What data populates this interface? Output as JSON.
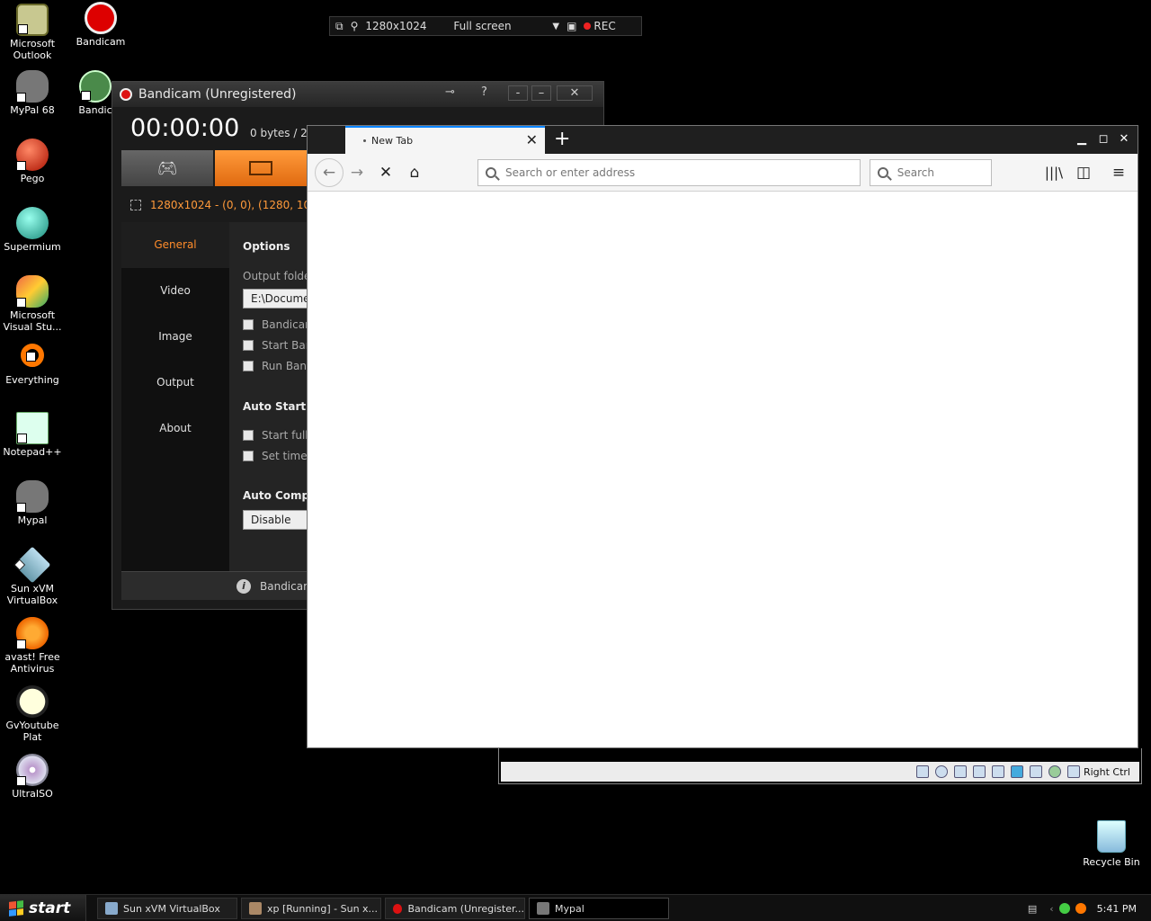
{
  "desktop": {
    "icons": [
      {
        "label": "Microsoft Outlook"
      },
      {
        "label": "Bandicam"
      },
      {
        "label": "MyPal 68"
      },
      {
        "label": "Bandic"
      },
      {
        "label": "Pego"
      },
      {
        "label": "Supermium"
      },
      {
        "label": "Microsoft Visual Stu..."
      },
      {
        "label": "Everything"
      },
      {
        "label": "Notepad++"
      },
      {
        "label": "Mypal"
      },
      {
        "label": "Sun xVM VirtualBox"
      },
      {
        "label": "avast! Free Antivirus"
      },
      {
        "label": "GvYoutube Plat"
      },
      {
        "label": "UltraISO"
      }
    ],
    "recycle_bin": "Recycle Bin"
  },
  "capture_bar": {
    "resolution": "1280x1024",
    "mode": "Full screen",
    "rec_label": "REC"
  },
  "bandicam": {
    "title": "Bandicam (Unregistered)",
    "help": "?",
    "timer": "00:00:00",
    "size": "0 bytes / 2",
    "region": "1280x1024 - (0, 0), (1280, 102",
    "nav": [
      "General",
      "Video",
      "Image",
      "Output",
      "About"
    ],
    "options_title": "Options",
    "output_folder_label": "Output folde",
    "output_folder_value": "E:\\Docume",
    "checkboxes": [
      "Bandicam",
      "Start Bar",
      "Run Banc"
    ],
    "auto_start_title": "Auto Start",
    "auto_start_checkboxes": [
      "Start full",
      "Set time"
    ],
    "auto_complete_title": "Auto Comp",
    "auto_complete_value": "Disable",
    "footer": "Bandicam"
  },
  "browser": {
    "tab_title": "New Tab",
    "url_placeholder": "Search or enter address",
    "search_placeholder": "Search"
  },
  "vbox": {
    "host_key": "Right Ctrl"
  },
  "taskbar": {
    "start_label": "start",
    "tasks": [
      {
        "label": "Sun xVM VirtualBox"
      },
      {
        "label": "xp [Running] - Sun x..."
      },
      {
        "label": "Bandicam (Unregister..."
      },
      {
        "label": "Mypal"
      }
    ],
    "clock": "5:41 PM"
  },
  "colors": {
    "bandicam_accent": "#ff8c2a",
    "rec_red": "#e22222",
    "browser_tab_accent": "#0a84ff"
  }
}
